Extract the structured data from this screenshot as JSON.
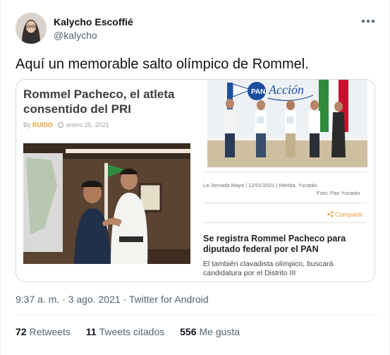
{
  "tweet": {
    "author_name": "Kalycho Escoffié",
    "author_handle": "@kalycho",
    "text": "Aquí un memorable salto olímpico de Rommel.",
    "timestamp": "9:37 a. m. · 3 ago. 2021 · Twitter for Android",
    "more_icon": "more-horizontal-icon"
  },
  "media": {
    "left_article": {
      "title": "Rommel Pacheco, el atleta consentido del PRI",
      "byline_prefix": "By",
      "source": "RUIDO",
      "date": "enero 25, 2021"
    },
    "right_article": {
      "photo_banner": "Acción",
      "caption": "La Jornada Maya | 12/01/2021 | Mérida, Yucatán",
      "photo_credit": "Foto: Pan Yucatán",
      "share_label": "Compartir",
      "headline": "Se registra Rommel Pacheco para diputado federal por el PAN",
      "subline": "El también clavadista olímpico, buscará candidatura por el Distrito III"
    }
  },
  "stats": {
    "retweets_count": "72",
    "retweets_label": "Retweets",
    "quotes_count": "11",
    "quotes_label": "Tweets citados",
    "likes_count": "556",
    "likes_label": "Me gusta"
  },
  "colors": {
    "text_primary": "#0f1419",
    "text_secondary": "#536471",
    "border": "#cfd9de",
    "accent_orange": "#e8a33c"
  }
}
